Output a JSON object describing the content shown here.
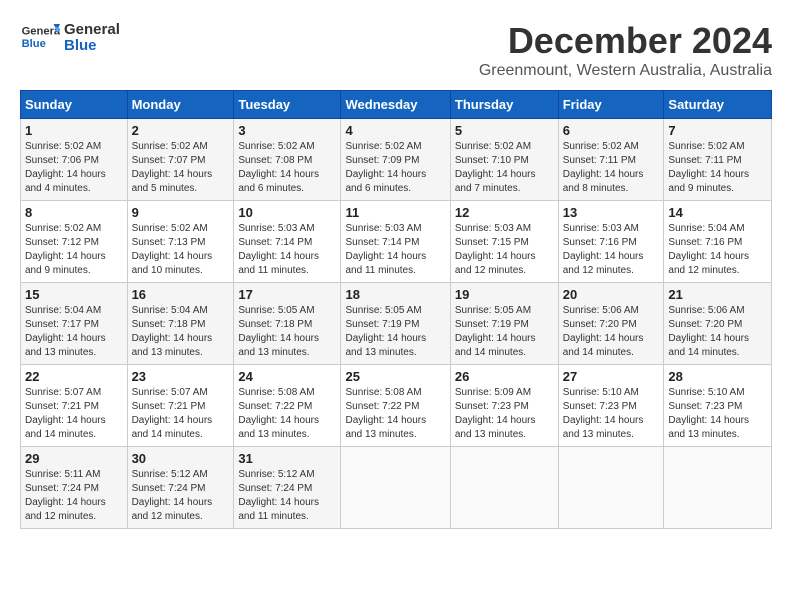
{
  "logo": {
    "line1": "General",
    "line2": "Blue"
  },
  "title": "December 2024",
  "subtitle": "Greenmount, Western Australia, Australia",
  "weekdays": [
    "Sunday",
    "Monday",
    "Tuesday",
    "Wednesday",
    "Thursday",
    "Friday",
    "Saturday"
  ],
  "weeks": [
    [
      {
        "day": "1",
        "sunrise": "5:02 AM",
        "sunset": "7:06 PM",
        "daylight": "14 hours and 4 minutes."
      },
      {
        "day": "2",
        "sunrise": "5:02 AM",
        "sunset": "7:07 PM",
        "daylight": "14 hours and 5 minutes."
      },
      {
        "day": "3",
        "sunrise": "5:02 AM",
        "sunset": "7:08 PM",
        "daylight": "14 hours and 6 minutes."
      },
      {
        "day": "4",
        "sunrise": "5:02 AM",
        "sunset": "7:09 PM",
        "daylight": "14 hours and 6 minutes."
      },
      {
        "day": "5",
        "sunrise": "5:02 AM",
        "sunset": "7:10 PM",
        "daylight": "14 hours and 7 minutes."
      },
      {
        "day": "6",
        "sunrise": "5:02 AM",
        "sunset": "7:11 PM",
        "daylight": "14 hours and 8 minutes."
      },
      {
        "day": "7",
        "sunrise": "5:02 AM",
        "sunset": "7:11 PM",
        "daylight": "14 hours and 9 minutes."
      }
    ],
    [
      {
        "day": "8",
        "sunrise": "5:02 AM",
        "sunset": "7:12 PM",
        "daylight": "14 hours and 9 minutes."
      },
      {
        "day": "9",
        "sunrise": "5:02 AM",
        "sunset": "7:13 PM",
        "daylight": "14 hours and 10 minutes."
      },
      {
        "day": "10",
        "sunrise": "5:03 AM",
        "sunset": "7:14 PM",
        "daylight": "14 hours and 11 minutes."
      },
      {
        "day": "11",
        "sunrise": "5:03 AM",
        "sunset": "7:14 PM",
        "daylight": "14 hours and 11 minutes."
      },
      {
        "day": "12",
        "sunrise": "5:03 AM",
        "sunset": "7:15 PM",
        "daylight": "14 hours and 12 minutes."
      },
      {
        "day": "13",
        "sunrise": "5:03 AM",
        "sunset": "7:16 PM",
        "daylight": "14 hours and 12 minutes."
      },
      {
        "day": "14",
        "sunrise": "5:04 AM",
        "sunset": "7:16 PM",
        "daylight": "14 hours and 12 minutes."
      }
    ],
    [
      {
        "day": "15",
        "sunrise": "5:04 AM",
        "sunset": "7:17 PM",
        "daylight": "14 hours and 13 minutes."
      },
      {
        "day": "16",
        "sunrise": "5:04 AM",
        "sunset": "7:18 PM",
        "daylight": "14 hours and 13 minutes."
      },
      {
        "day": "17",
        "sunrise": "5:05 AM",
        "sunset": "7:18 PM",
        "daylight": "14 hours and 13 minutes."
      },
      {
        "day": "18",
        "sunrise": "5:05 AM",
        "sunset": "7:19 PM",
        "daylight": "14 hours and 13 minutes."
      },
      {
        "day": "19",
        "sunrise": "5:05 AM",
        "sunset": "7:19 PM",
        "daylight": "14 hours and 14 minutes."
      },
      {
        "day": "20",
        "sunrise": "5:06 AM",
        "sunset": "7:20 PM",
        "daylight": "14 hours and 14 minutes."
      },
      {
        "day": "21",
        "sunrise": "5:06 AM",
        "sunset": "7:20 PM",
        "daylight": "14 hours and 14 minutes."
      }
    ],
    [
      {
        "day": "22",
        "sunrise": "5:07 AM",
        "sunset": "7:21 PM",
        "daylight": "14 hours and 14 minutes."
      },
      {
        "day": "23",
        "sunrise": "5:07 AM",
        "sunset": "7:21 PM",
        "daylight": "14 hours and 14 minutes."
      },
      {
        "day": "24",
        "sunrise": "5:08 AM",
        "sunset": "7:22 PM",
        "daylight": "14 hours and 13 minutes."
      },
      {
        "day": "25",
        "sunrise": "5:08 AM",
        "sunset": "7:22 PM",
        "daylight": "14 hours and 13 minutes."
      },
      {
        "day": "26",
        "sunrise": "5:09 AM",
        "sunset": "7:23 PM",
        "daylight": "14 hours and 13 minutes."
      },
      {
        "day": "27",
        "sunrise": "5:10 AM",
        "sunset": "7:23 PM",
        "daylight": "14 hours and 13 minutes."
      },
      {
        "day": "28",
        "sunrise": "5:10 AM",
        "sunset": "7:23 PM",
        "daylight": "14 hours and 13 minutes."
      }
    ],
    [
      {
        "day": "29",
        "sunrise": "5:11 AM",
        "sunset": "7:24 PM",
        "daylight": "14 hours and 12 minutes."
      },
      {
        "day": "30",
        "sunrise": "5:12 AM",
        "sunset": "7:24 PM",
        "daylight": "14 hours and 12 minutes."
      },
      {
        "day": "31",
        "sunrise": "5:12 AM",
        "sunset": "7:24 PM",
        "daylight": "14 hours and 11 minutes."
      },
      null,
      null,
      null,
      null
    ]
  ],
  "labels": {
    "sunrise": "Sunrise:",
    "sunset": "Sunset:",
    "daylight": "Daylight:"
  }
}
